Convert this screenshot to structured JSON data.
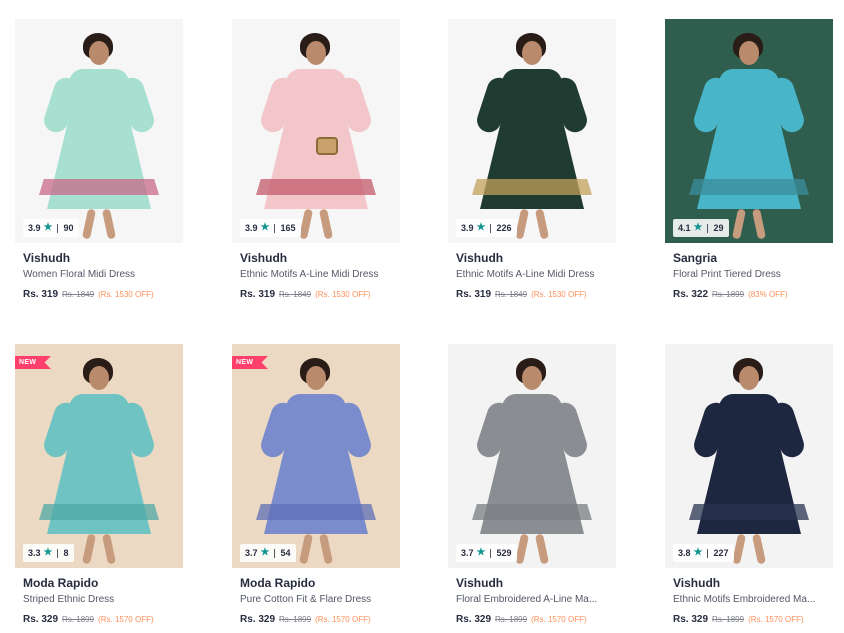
{
  "products": [
    {
      "brand": "Vishudh",
      "name": "Women Floral Midi Dress",
      "price": "Rs. 319",
      "mrp": "Rs. 1849",
      "discount": "(Rs. 1530 OFF)",
      "rating": "3.9",
      "rating_count": "90",
      "new": false,
      "colors": {
        "bg": "#f6f6f7",
        "dress": "#a7e0d0",
        "band": "#c86a8a"
      }
    },
    {
      "brand": "Vishudh",
      "name": "Ethnic Motifs A-Line Midi Dress",
      "price": "Rs. 319",
      "mrp": "Rs. 1849",
      "discount": "(Rs. 1530 OFF)",
      "rating": "3.9",
      "rating_count": "165",
      "new": false,
      "colors": {
        "bg": "#f6f6f7",
        "dress": "#f3c7c9",
        "band": "#c45a6b"
      }
    },
    {
      "brand": "Vishudh",
      "name": "Ethnic Motifs A-Line Midi Dress",
      "price": "Rs. 319",
      "mrp": "Rs. 1849",
      "discount": "(Rs. 1530 OFF)",
      "rating": "3.9",
      "rating_count": "226",
      "new": false,
      "colors": {
        "bg": "#f6f6f7",
        "dress": "#1f3b32",
        "band": "#c3a05a"
      }
    },
    {
      "brand": "Sangria",
      "name": "Floral Print Tiered Dress",
      "price": "Rs. 322",
      "mrp": "Rs. 1899",
      "discount": "(83% OFF)",
      "rating": "4.1",
      "rating_count": "29",
      "new": false,
      "colors": {
        "bg": "#2f5e4e",
        "dress": "#49b5c8",
        "band": "#3b8e9c"
      }
    },
    {
      "brand": "Moda Rapido",
      "name": "Striped Ethnic Dress",
      "price": "Rs. 329",
      "mrp": "Rs. 1899",
      "discount": "(Rs. 1570 OFF)",
      "rating": "3.3",
      "rating_count": "8",
      "new": true,
      "new_label": "NEW",
      "colors": {
        "bg": "#ecd9c3",
        "dress": "#6fc4c3",
        "band": "#4fa7a6"
      }
    },
    {
      "brand": "Moda Rapido",
      "name": "Pure Cotton Fit & Flare Dress",
      "price": "Rs. 329",
      "mrp": "Rs. 1899",
      "discount": "(Rs. 1570 OFF)",
      "rating": "3.7",
      "rating_count": "54",
      "new": true,
      "new_label": "NEW",
      "colors": {
        "bg": "#ecd9c3",
        "dress": "#7b8ccd",
        "band": "#5d6fb5"
      }
    },
    {
      "brand": "Vishudh",
      "name": "Floral Embroidered A-Line Ma...",
      "price": "Rs. 329",
      "mrp": "Rs. 1899",
      "discount": "(Rs. 1570 OFF)",
      "rating": "3.7",
      "rating_count": "529",
      "new": false,
      "colors": {
        "bg": "#f3f3f3",
        "dress": "#8a8d92",
        "band": "#7a7d82"
      }
    },
    {
      "brand": "Vishudh",
      "name": "Ethnic Motifs Embroidered Ma...",
      "price": "Rs. 329",
      "mrp": "Rs. 1899",
      "discount": "(Rs. 1570 OFF)",
      "rating": "3.8",
      "rating_count": "227",
      "new": false,
      "colors": {
        "bg": "#f3f3f3",
        "dress": "#1e2740",
        "band": "#2a3452"
      }
    }
  ],
  "icons": {
    "rating_star": "star-icon"
  },
  "accent_colors": {
    "star": "#14958f",
    "discount": "#ff905a",
    "new_tag": "#ff3f6c"
  }
}
